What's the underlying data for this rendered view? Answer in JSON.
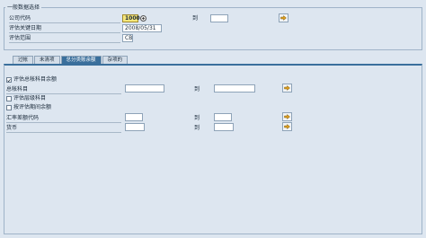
{
  "selection_group": {
    "title": "一般数据选择",
    "company_code_label": "公司代码",
    "company_code_value": "1000",
    "to_label": "到",
    "valuation_date_label": "评估关键日期",
    "valuation_date_value": "2008/05/31",
    "valuation_area_label": "评估范围",
    "valuation_area_value": "CB"
  },
  "tabs": [
    {
      "label": "过帐",
      "active": false
    },
    {
      "label": "未清项",
      "active": false
    },
    {
      "label": "总分类账余额",
      "active": true
    },
    {
      "label": "杂项的",
      "active": false
    }
  ],
  "panel": {
    "eval_gl_balance_label": "评估总帐科目余额",
    "eval_gl_balance_checked": true,
    "gl_account_label": "总帐科目",
    "to_label_1": "到",
    "eval_fx_account_label": "评估层级科目",
    "eval_fx_account_checked": false,
    "valuate_period_balance_label": "按评估期间余额",
    "valuate_period_balance_checked": false,
    "fx_type_label": "汇率差额代码",
    "to_label_2": "到",
    "currency_label": "货币",
    "to_label_3": "到"
  },
  "colors": {
    "background": "#dde6f0",
    "active_tab": "#3a6f9c",
    "highlight_field": "#f7e77a"
  }
}
